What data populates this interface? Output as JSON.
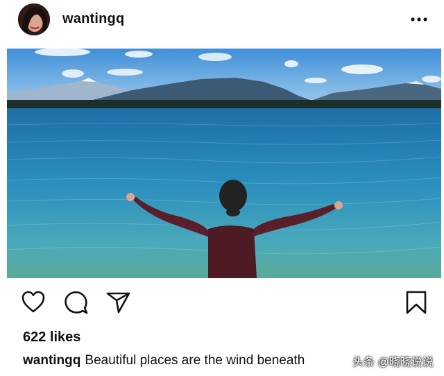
{
  "post": {
    "username": "wantingq",
    "image_alt": "woman with outstretched arms facing a clear blue mountain lake",
    "likes_text": "622 likes",
    "caption_user": "wantingq",
    "caption_text": "Beautiful places are the wind beneath"
  },
  "icons": {
    "more": "more-dots-icon",
    "like": "heart-icon",
    "comment": "comment-bubble-icon",
    "share": "paper-plane-icon",
    "save": "bookmark-icon"
  },
  "watermark": {
    "text": "头条 @晓晓说说"
  },
  "colors": {
    "text": "#111111",
    "background": "#ffffff",
    "icon": "#111111"
  }
}
